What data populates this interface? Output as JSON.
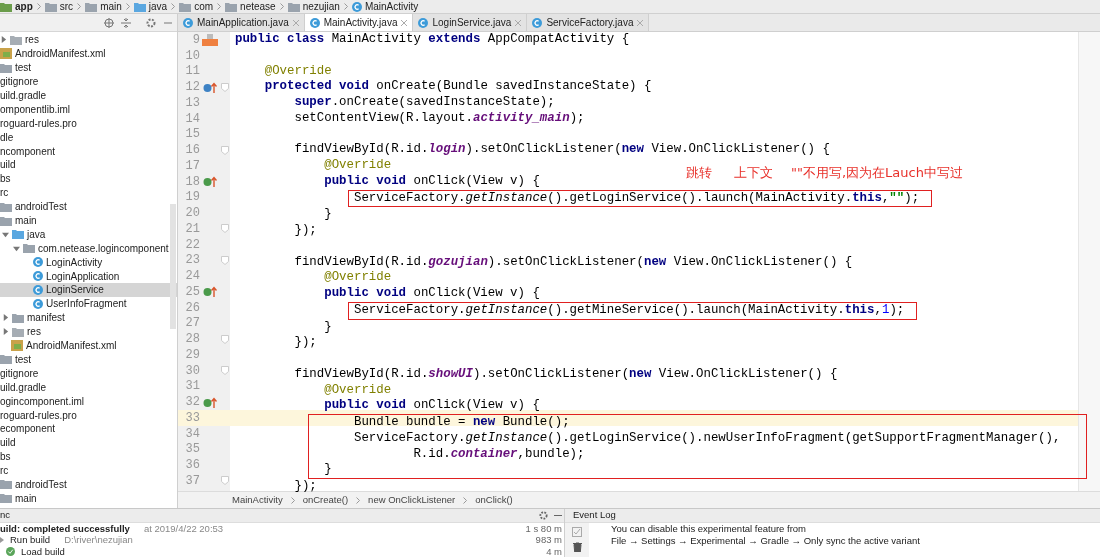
{
  "nav_bar": {
    "crumbs": [
      {
        "label": "app",
        "kind": "module"
      },
      {
        "label": "src",
        "kind": "folder"
      },
      {
        "label": "main",
        "kind": "folder"
      },
      {
        "label": "java",
        "kind": "source"
      },
      {
        "label": "com",
        "kind": "folder"
      },
      {
        "label": "netease",
        "kind": "folder"
      },
      {
        "label": "nezujian",
        "kind": "folder"
      },
      {
        "label": "MainActivity",
        "kind": "class"
      }
    ]
  },
  "project_tree": [
    {
      "label": "res",
      "kind": "resfolder",
      "expanded": false
    },
    {
      "label": "AndroidManifest.xml",
      "kind": "manifest"
    },
    {
      "label": "test",
      "kind": "folder"
    },
    {
      "label": "gitignore",
      "kind": "file"
    },
    {
      "label": "uild.gradle",
      "kind": "file"
    },
    {
      "label": "omponentlib.iml",
      "kind": "file"
    },
    {
      "label": "roguard-rules.pro",
      "kind": "file"
    },
    {
      "label": "dle",
      "kind": "file"
    },
    {
      "label": "ncomponent",
      "kind": "file"
    },
    {
      "label": "uild",
      "kind": "file"
    },
    {
      "label": "bs",
      "kind": "file"
    },
    {
      "label": "rc",
      "kind": "file"
    },
    {
      "label": "androidTest",
      "kind": "folder"
    },
    {
      "label": "main",
      "kind": "folder",
      "children": [
        {
          "label": "java",
          "kind": "source",
          "expanded": true,
          "children": [
            {
              "label": "com.netease.logincomponent",
              "kind": "folder",
              "expanded": true,
              "children": [
                {
                  "label": "LoginActivity",
                  "kind": "class",
                  "selected": false
                },
                {
                  "label": "LoginApplication",
                  "kind": "class",
                  "selected": false
                },
                {
                  "label": "LoginService",
                  "kind": "class",
                  "selected": true
                },
                {
                  "label": "UserInfoFragment",
                  "kind": "class",
                  "selected": false
                }
              ]
            }
          ]
        },
        {
          "label": "manifest",
          "kind": "folder",
          "expanded": false
        },
        {
          "label": "res",
          "kind": "resfolder",
          "expanded": false
        },
        {
          "label": "AndroidManifest.xml",
          "kind": "manifest"
        }
      ]
    },
    {
      "label": "test",
      "kind": "folder"
    },
    {
      "label": "gitignore",
      "kind": "file"
    },
    {
      "label": "uild.gradle",
      "kind": "file"
    },
    {
      "label": "ogincomponent.iml",
      "kind": "file"
    },
    {
      "label": "roguard-rules.pro",
      "kind": "file"
    },
    {
      "label": "ecomponent",
      "kind": "file"
    },
    {
      "label": "uild",
      "kind": "file"
    },
    {
      "label": "bs",
      "kind": "file"
    },
    {
      "label": "rc",
      "kind": "file"
    },
    {
      "label": "androidTest",
      "kind": "folder"
    },
    {
      "label": "main",
      "kind": "folder"
    }
  ],
  "editor_tabs": [
    {
      "label": "MainApplication.java",
      "selected": false
    },
    {
      "label": "MainActivity.java",
      "selected": true
    },
    {
      "label": "LoginService.java",
      "selected": false
    },
    {
      "label": "ServiceFactory.java",
      "selected": false
    }
  ],
  "code": [
    {
      "num": "9",
      "marker": {
        "kind": "source"
      },
      "segs": [
        {
          "kind": "kw",
          "t": "public class "
        },
        {
          "kind": "p",
          "t": "MainActivity "
        },
        {
          "kind": "kw",
          "t": "extends "
        },
        {
          "kind": "p",
          "t": "AppCompatActivity {"
        }
      ]
    },
    {
      "num": "10"
    },
    {
      "num": "11",
      "segs": [
        {
          "kind": "ann",
          "t": "    @Override"
        }
      ]
    },
    {
      "num": "12",
      "marker": {
        "kind": "override"
      },
      "fold": true,
      "segs": [
        {
          "kind": "kw",
          "t": "    protected void "
        },
        {
          "kind": "p",
          "t": "onCreate(Bundle savedInstanceState) {"
        }
      ]
    },
    {
      "num": "13",
      "segs": [
        {
          "kind": "kw",
          "t": "        super"
        },
        {
          "kind": "p",
          "t": ".onCreate(savedInstanceState);"
        }
      ]
    },
    {
      "num": "14",
      "segs": [
        {
          "kind": "p",
          "t": "        setContentView(R.layout."
        },
        {
          "kind": "field",
          "t": "activity_main"
        },
        {
          "kind": "p",
          "t": ");"
        }
      ]
    },
    {
      "num": "15"
    },
    {
      "num": "16",
      "fold": true,
      "segs": [
        {
          "kind": "p",
          "t": "        findViewById(R.id."
        },
        {
          "kind": "field",
          "t": "login"
        },
        {
          "kind": "p",
          "t": ").setOnClickListener("
        },
        {
          "kind": "kw",
          "t": "new "
        },
        {
          "kind": "p",
          "t": "View.OnClickListener() {"
        }
      ]
    },
    {
      "num": "17",
      "segs": [
        {
          "kind": "ann",
          "t": "            @Override"
        }
      ]
    },
    {
      "num": "18",
      "marker": {
        "kind": "implement"
      },
      "segs": [
        {
          "kind": "kw",
          "t": "            public void "
        },
        {
          "kind": "p",
          "t": "onClick(View v) {"
        }
      ]
    },
    {
      "num": "19",
      "boxed": true,
      "segs": [
        {
          "kind": "p",
          "t": "                ServiceFactory."
        },
        {
          "kind": "static",
          "t": "getInstance"
        },
        {
          "kind": "p",
          "t": "().getLoginService().launch(MainActivity."
        },
        {
          "kind": "kw",
          "t": "this"
        },
        {
          "kind": "p",
          "t": ","
        },
        {
          "kind": "str",
          "t": "\"\""
        },
        {
          "kind": "p",
          "t": ");"
        }
      ]
    },
    {
      "num": "20",
      "segs": [
        {
          "kind": "p",
          "t": "            }"
        }
      ]
    },
    {
      "num": "21",
      "fold": true,
      "segs": [
        {
          "kind": "p",
          "t": "        });"
        }
      ]
    },
    {
      "num": "22"
    },
    {
      "num": "23",
      "fold": true,
      "segs": [
        {
          "kind": "p",
          "t": "        findViewById(R.id."
        },
        {
          "kind": "field",
          "t": "gozujian"
        },
        {
          "kind": "p",
          "t": ").setOnClickListener("
        },
        {
          "kind": "kw",
          "t": "new "
        },
        {
          "kind": "p",
          "t": "View.OnClickListener() {"
        }
      ]
    },
    {
      "num": "24",
      "segs": [
        {
          "kind": "ann",
          "t": "            @Override"
        }
      ]
    },
    {
      "num": "25",
      "marker": {
        "kind": "implement"
      },
      "segs": [
        {
          "kind": "kw",
          "t": "            public void "
        },
        {
          "kind": "p",
          "t": "onClick(View v) {"
        }
      ]
    },
    {
      "num": "26",
      "boxed": true,
      "segs": [
        {
          "kind": "p",
          "t": "                ServiceFactory."
        },
        {
          "kind": "static",
          "t": "getInstance"
        },
        {
          "kind": "p",
          "t": "().getMineService().launch(MainActivity."
        },
        {
          "kind": "kw",
          "t": "this"
        },
        {
          "kind": "p",
          "t": ","
        },
        {
          "kind": "num",
          "t": "1"
        },
        {
          "kind": "p",
          "t": ");"
        }
      ]
    },
    {
      "num": "27",
      "segs": [
        {
          "kind": "p",
          "t": "            }"
        }
      ]
    },
    {
      "num": "28",
      "fold": true,
      "segs": [
        {
          "kind": "p",
          "t": "        });"
        }
      ]
    },
    {
      "num": "29"
    },
    {
      "num": "30",
      "fold": true,
      "segs": [
        {
          "kind": "p",
          "t": "        findViewById(R.id."
        },
        {
          "kind": "field",
          "t": "showUI"
        },
        {
          "kind": "p",
          "t": ").setOnClickListener("
        },
        {
          "kind": "kw",
          "t": "new "
        },
        {
          "kind": "p",
          "t": "View.OnClickListener() {"
        }
      ]
    },
    {
      "num": "31",
      "segs": [
        {
          "kind": "ann",
          "t": "            @Override"
        }
      ]
    },
    {
      "num": "32",
      "marker": {
        "kind": "implement"
      },
      "segs": [
        {
          "kind": "kw",
          "t": "            public void "
        },
        {
          "kind": "p",
          "t": "onClick(View v) {"
        }
      ]
    },
    {
      "num": "33",
      "current": true,
      "boxed": true,
      "segs": [
        {
          "kind": "p",
          "t": "                Bundle bundle = "
        },
        {
          "kind": "kw",
          "t": "new "
        },
        {
          "kind": "p",
          "t": "Bundle();"
        }
      ]
    },
    {
      "num": "34",
      "boxed": true,
      "segs": [
        {
          "kind": "p",
          "t": "                ServiceFactory."
        },
        {
          "kind": "static",
          "t": "getInstance"
        },
        {
          "kind": "p",
          "t": "().getLoginService().newUserInfoFragment(getSupportFragmentManager(),"
        }
      ]
    },
    {
      "num": "35",
      "boxed": true,
      "segs": [
        {
          "kind": "p",
          "t": "                        R.id."
        },
        {
          "kind": "field",
          "t": "container"
        },
        {
          "kind": "p",
          "t": ",bundle);"
        }
      ]
    },
    {
      "num": "36",
      "boxed": true,
      "segs": [
        {
          "kind": "p",
          "t": "            }"
        }
      ]
    },
    {
      "num": "37",
      "fold": true,
      "segs": [
        {
          "kind": "p",
          "t": "        });"
        }
      ]
    }
  ],
  "annotations": [
    "跳转",
    "上下文",
    "\"\"不用写,因为在Lauch中写过"
  ],
  "editor_breadcrumb": [
    "MainActivity",
    "onCreate()",
    "new OnClickListener",
    "onClick()"
  ],
  "build_panel": {
    "title": "nc",
    "rows": [
      {
        "kind": "status",
        "label": "uild: completed successfully",
        "detail": "at 2019/4/22 20:53",
        "time": "1 s 80 m"
      },
      {
        "kind": "task",
        "label": "Run build",
        "detail": "D:\\river\\nezujian",
        "time": "983 m"
      },
      {
        "kind": "done",
        "label": "Load build",
        "time": "4 m"
      }
    ]
  },
  "event_log": {
    "title": "Event Log",
    "lines": [
      "You can disable this experimental feature from",
      "File → Settings → Experimental → Gradle → Only sync the active variant"
    ]
  }
}
